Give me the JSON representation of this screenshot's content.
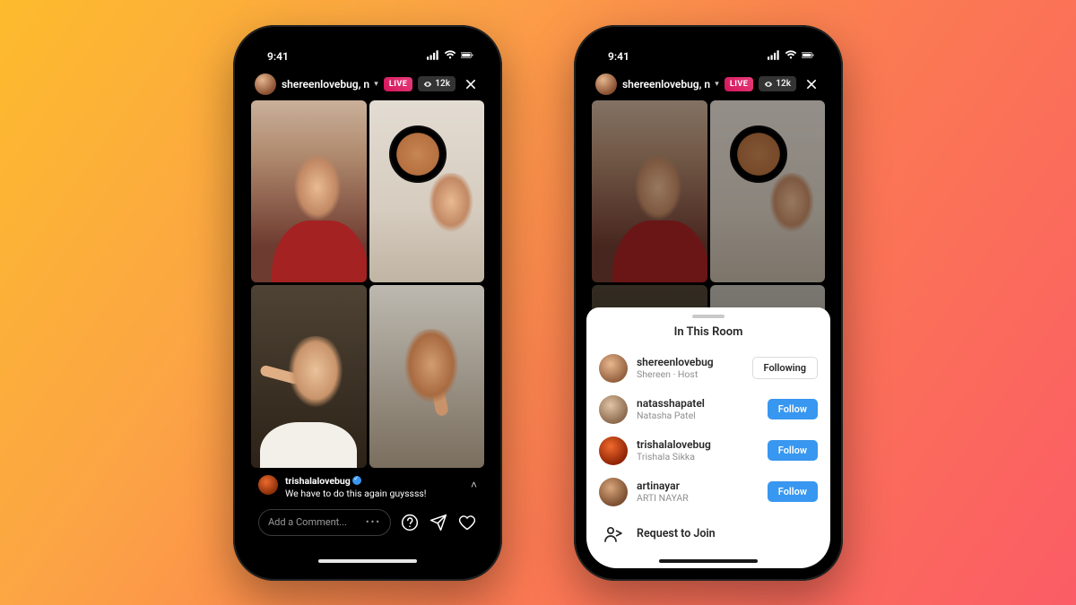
{
  "status": {
    "time": "9:41"
  },
  "header": {
    "host_username": "shereenlovebug, n…",
    "live_label": "LIVE",
    "viewers": "12k"
  },
  "comment": {
    "username": "trishalalovebug",
    "text": "We have to do this again guyssss!"
  },
  "composer": {
    "placeholder": "Add a Comment..."
  },
  "sheet": {
    "title": "In This Room",
    "users": [
      {
        "username": "shereenlovebug",
        "subtitle": "Shereen · Host",
        "button": "Following",
        "state": "following"
      },
      {
        "username": "natasshapatel",
        "subtitle": "Natasha Patel",
        "button": "Follow",
        "state": "follow"
      },
      {
        "username": "trishalalovebug",
        "subtitle": "Trishala Sikka",
        "button": "Follow",
        "state": "follow"
      },
      {
        "username": "artinayar",
        "subtitle": "ARTI NAYAR",
        "button": "Follow",
        "state": "follow"
      }
    ],
    "request_label": "Request to Join"
  }
}
